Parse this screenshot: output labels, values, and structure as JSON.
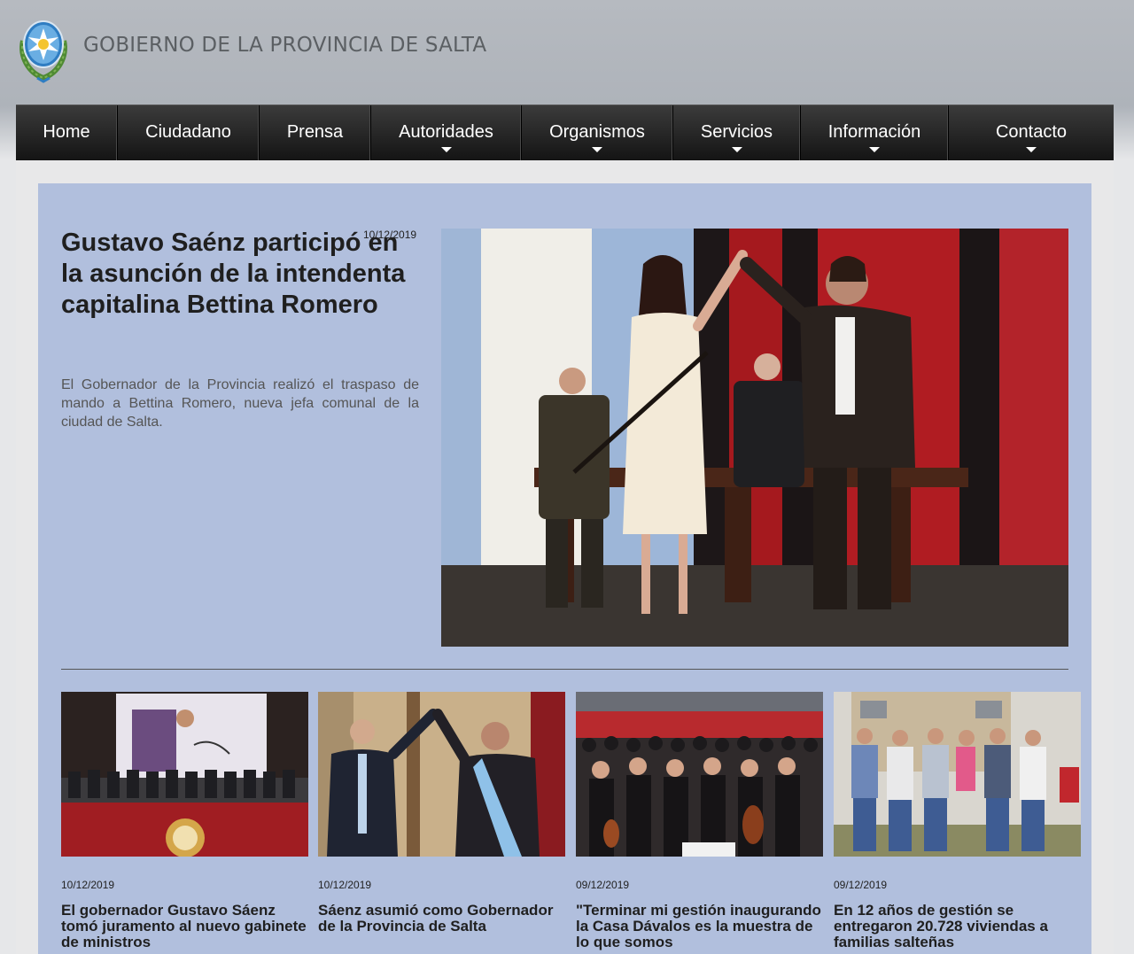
{
  "header": {
    "site_title": "GOBIERNO DE LA PROVINCIA DE SALTA",
    "logo_icon": "salta-coat-of-arms-icon"
  },
  "nav": {
    "items": [
      {
        "label": "Home",
        "has_dropdown": false
      },
      {
        "label": "Ciudadano",
        "has_dropdown": false
      },
      {
        "label": "Prensa",
        "has_dropdown": false
      },
      {
        "label": "Autoridades",
        "has_dropdown": true
      },
      {
        "label": "Organismos",
        "has_dropdown": true
      },
      {
        "label": "Servicios",
        "has_dropdown": true
      },
      {
        "label": "Información",
        "has_dropdown": true
      },
      {
        "label": "Contacto",
        "has_dropdown": true
      }
    ]
  },
  "featured": {
    "date": "10/12/2019",
    "title": "Gustavo Saénz participó en la asunción de la intendenta capitalina Bettina Romero",
    "summary": "El Gobernador de la Provincia realizó el traspaso de mando a Bettina Romero, nueva jefa comunal de la ciudad de Salta."
  },
  "news": [
    {
      "date": "10/12/2019",
      "title": "El gobernador Gustavo Sáenz tomó juramento al nuevo gabinete de ministros"
    },
    {
      "date": "10/12/2019",
      "title": "Sáenz asumió como Gobernador de la Provincia de Salta"
    },
    {
      "date": "09/12/2019",
      "title": "\"Terminar mi gestión inaugurando la Casa Dávalos es la muestra de lo que somos"
    },
    {
      "date": "09/12/2019",
      "title": "En 12 años de gestión se entregaron 20.728 viviendas a familias salteñas"
    }
  ],
  "colors": {
    "panel": "#b1bfdd",
    "nav": "#1a1a1a"
  }
}
